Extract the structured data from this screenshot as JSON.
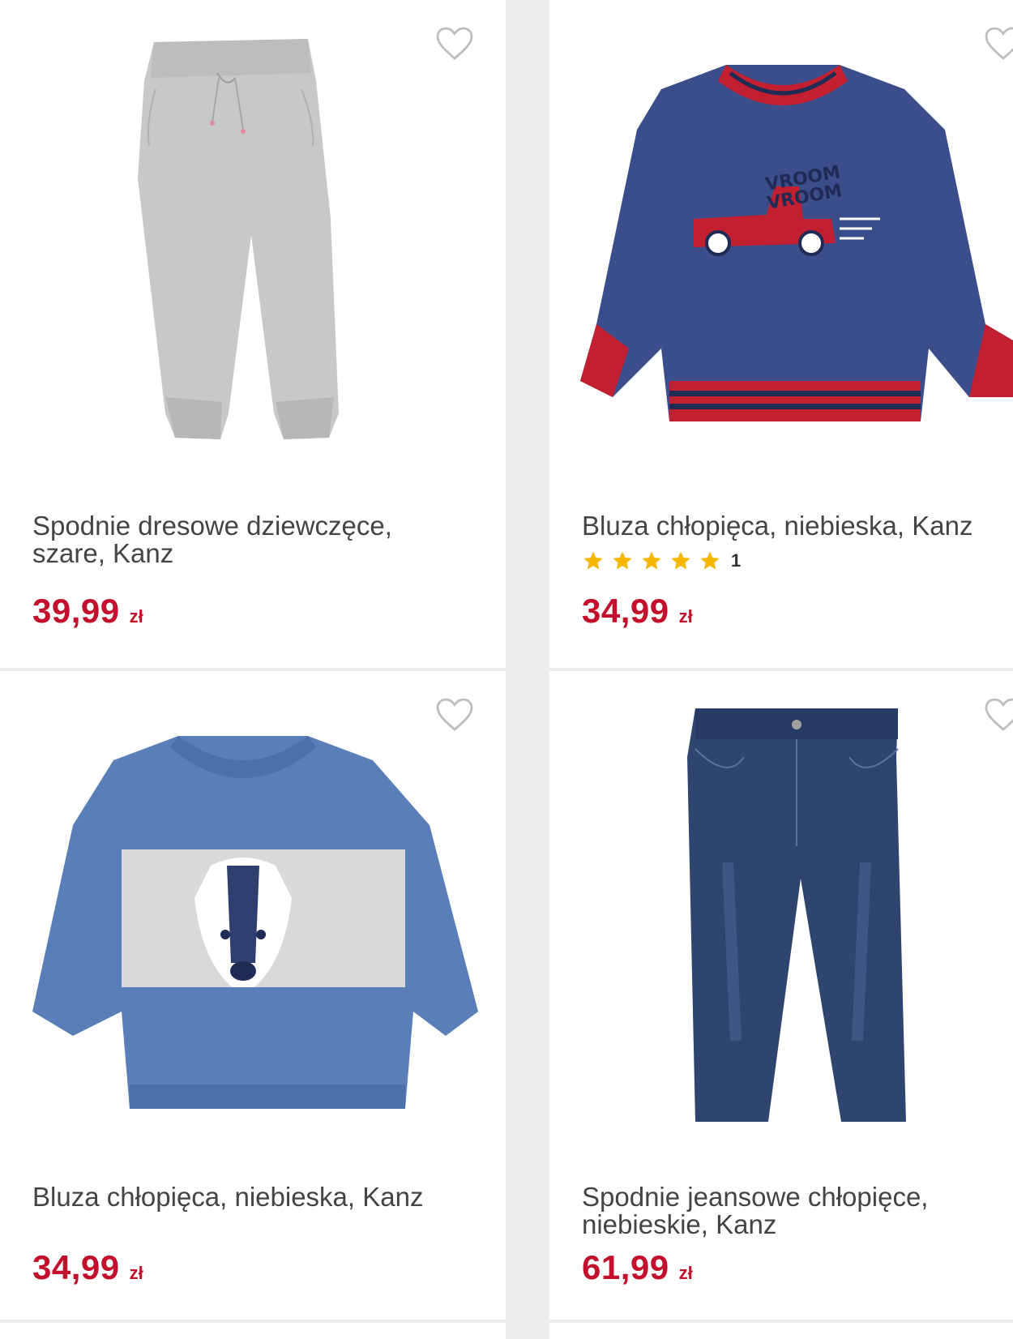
{
  "products": [
    {
      "title": "Spodnie dresowe dziewczęce, szare, Kanz",
      "price": "39,99",
      "currency": "zł",
      "image_icon": "grey-sweatpants-image"
    },
    {
      "title": "Bluza chłopięca, niebieska, Kanz",
      "price": "34,99",
      "currency": "zł",
      "rating": 5,
      "rating_count": "1",
      "image_icon": "navy-truck-sweatshirt-image",
      "print_text": [
        "VROOM",
        "VROOM"
      ]
    },
    {
      "title": "Bluza chłopięca, niebieska, Kanz",
      "price": "34,99",
      "currency": "zł",
      "image_icon": "blue-badger-sweatshirt-image"
    },
    {
      "title": "Spodnie jeansowe chłopięce, niebieskie, Kanz",
      "price": "61,99",
      "currency": "zł",
      "image_icon": "blue-jeans-image"
    }
  ],
  "colors": {
    "price": "#c2102d",
    "star": "#f5b800",
    "background": "#ececec"
  }
}
